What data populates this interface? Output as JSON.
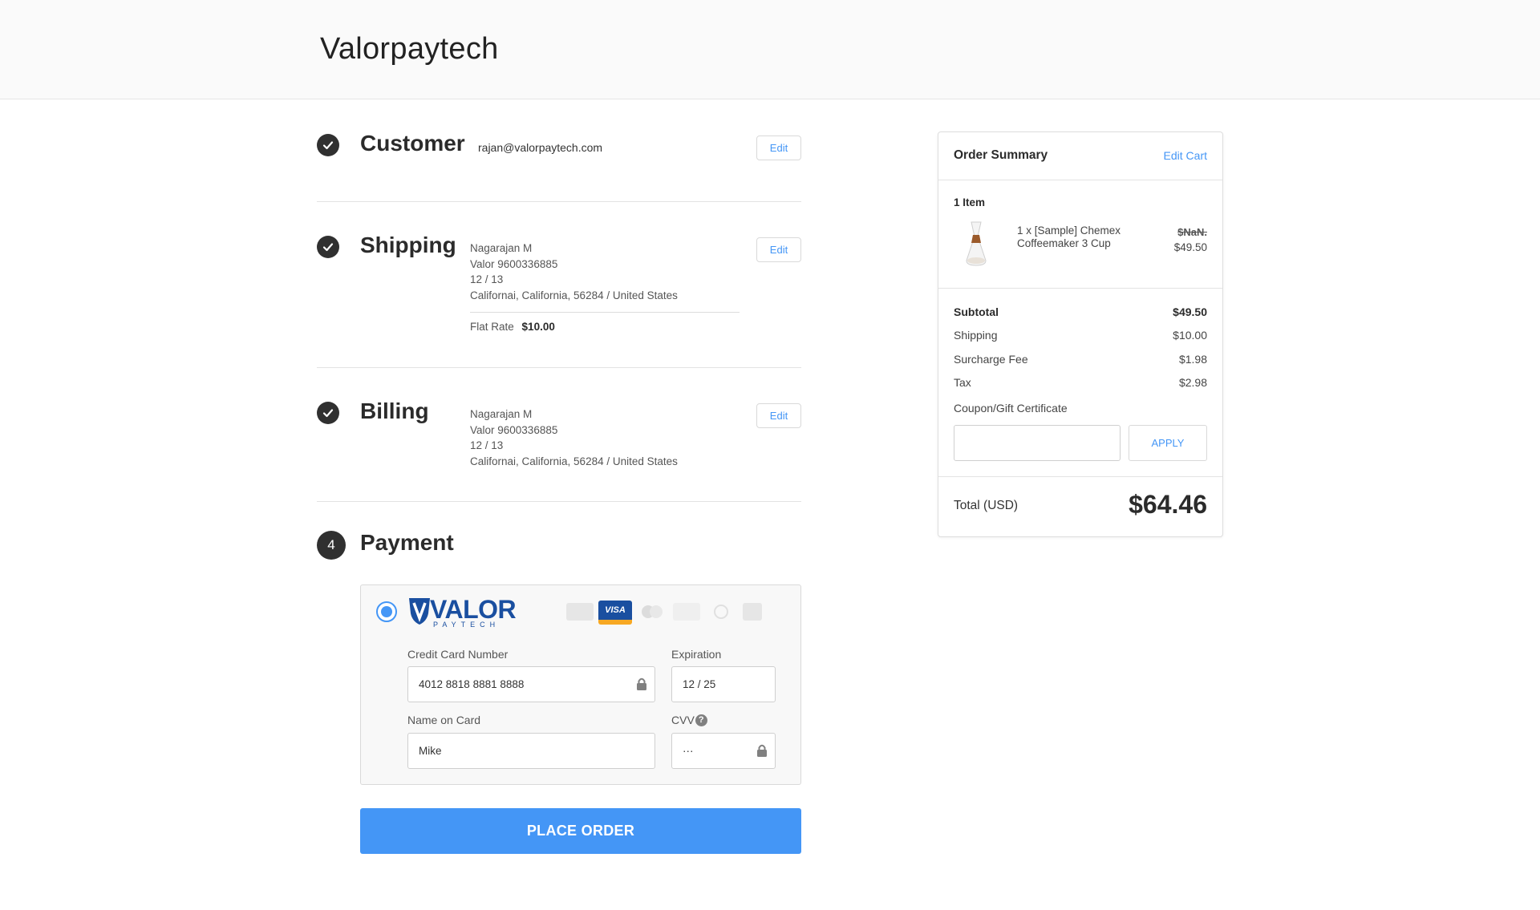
{
  "brand": "Valorpaytech",
  "customer": {
    "step_title": "Customer",
    "email": "rajan@valorpaytech.com",
    "edit_label": "Edit"
  },
  "shipping": {
    "step_title": "Shipping",
    "name": "Nagarajan M",
    "line2": "Valor 9600336885",
    "line3": "12 / 13",
    "line4": "Californai, California, 56284 / United States",
    "method_label": "Flat Rate",
    "method_price": "$10.00",
    "edit_label": "Edit"
  },
  "billing": {
    "step_title": "Billing",
    "name": "Nagarajan M",
    "line2": "Valor 9600336885",
    "line3": "12 / 13",
    "line4": "Californai, California, 56284 / United States",
    "edit_label": "Edit"
  },
  "payment": {
    "step_number": "4",
    "step_title": "Payment",
    "provider_logo_text": "VALOR",
    "provider_logo_subtext": "PAYTECH",
    "card_icons": [
      "amex-icon",
      "visa-icon",
      "mastercard-icon",
      "discover-icon",
      "diners-icon",
      "jcb-icon"
    ],
    "visa_text": "VISA",
    "card_number_label": "Credit Card Number",
    "card_number_value": "4012 8818 8881 8888",
    "expiration_label": "Expiration",
    "expiration_value": "12 / 25",
    "name_label": "Name on Card",
    "name_value": "Mike",
    "cvv_label": "CVV",
    "cvv_value": "···",
    "place_order_label": "PLACE ORDER"
  },
  "summary": {
    "title": "Order Summary",
    "edit_cart_label": "Edit Cart",
    "item_count": "1 Item",
    "item_name": "1 x [Sample] Chemex Coffeemaker 3 Cup",
    "item_old_price": "$NaN.",
    "item_price": "$49.50",
    "subtotal_label": "Subtotal",
    "subtotal_value": "$49.50",
    "shipping_label": "Shipping",
    "shipping_value": "$10.00",
    "surcharge_label": "Surcharge Fee",
    "surcharge_value": "$1.98",
    "tax_label": "Tax",
    "tax_value": "$2.98",
    "coupon_label": "Coupon/Gift Certificate",
    "coupon_placeholder": "",
    "apply_label": "APPLY",
    "total_label": "Total (USD)",
    "total_value": "$64.46"
  },
  "colors": {
    "accent": "#4496f6",
    "step_icon": "#303030",
    "visa_blue": "#1a4fa0",
    "visa_gold": "#f7a823"
  }
}
